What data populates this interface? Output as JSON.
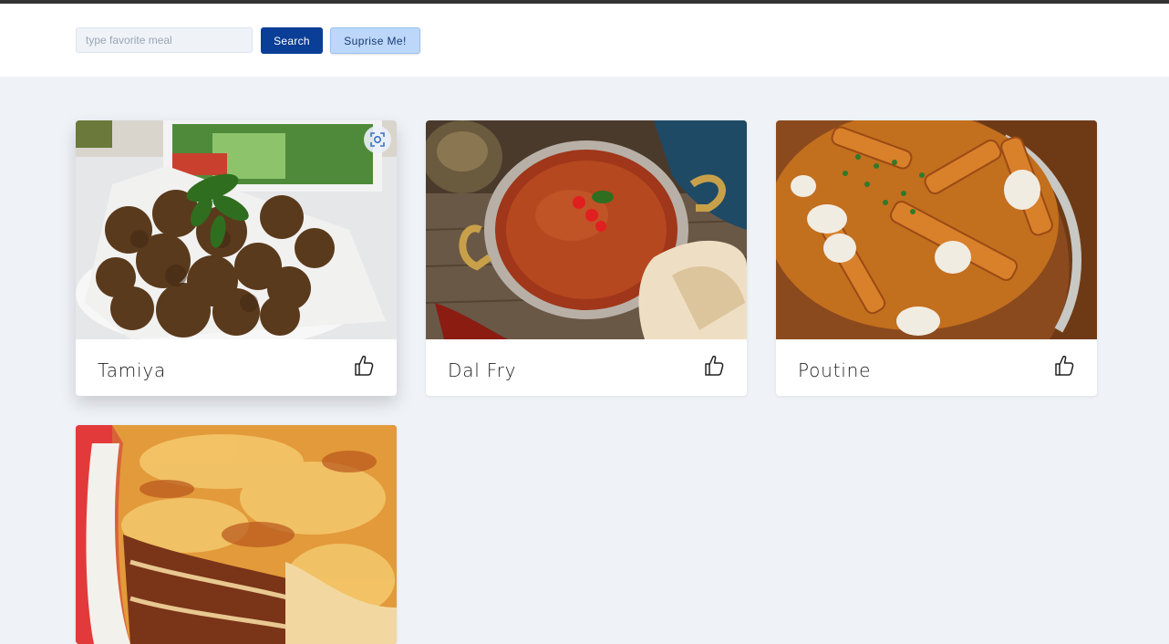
{
  "search": {
    "placeholder": "type favorite meal",
    "value": ""
  },
  "toolbar": {
    "search_label": "Search",
    "surprise_label": "Suprise Me!"
  },
  "meals": [
    {
      "name": "Tamiya"
    },
    {
      "name": "Dal Fry"
    },
    {
      "name": "Poutine"
    },
    {
      "name": ""
    }
  ],
  "icons": {
    "like": "thumbs-up-icon",
    "visual_search": "visual-search-icon"
  },
  "colors": {
    "primary": "#0b3e96",
    "secondary": "#bcd7fa",
    "background": "#eff2f7",
    "topbar": "#333333"
  }
}
